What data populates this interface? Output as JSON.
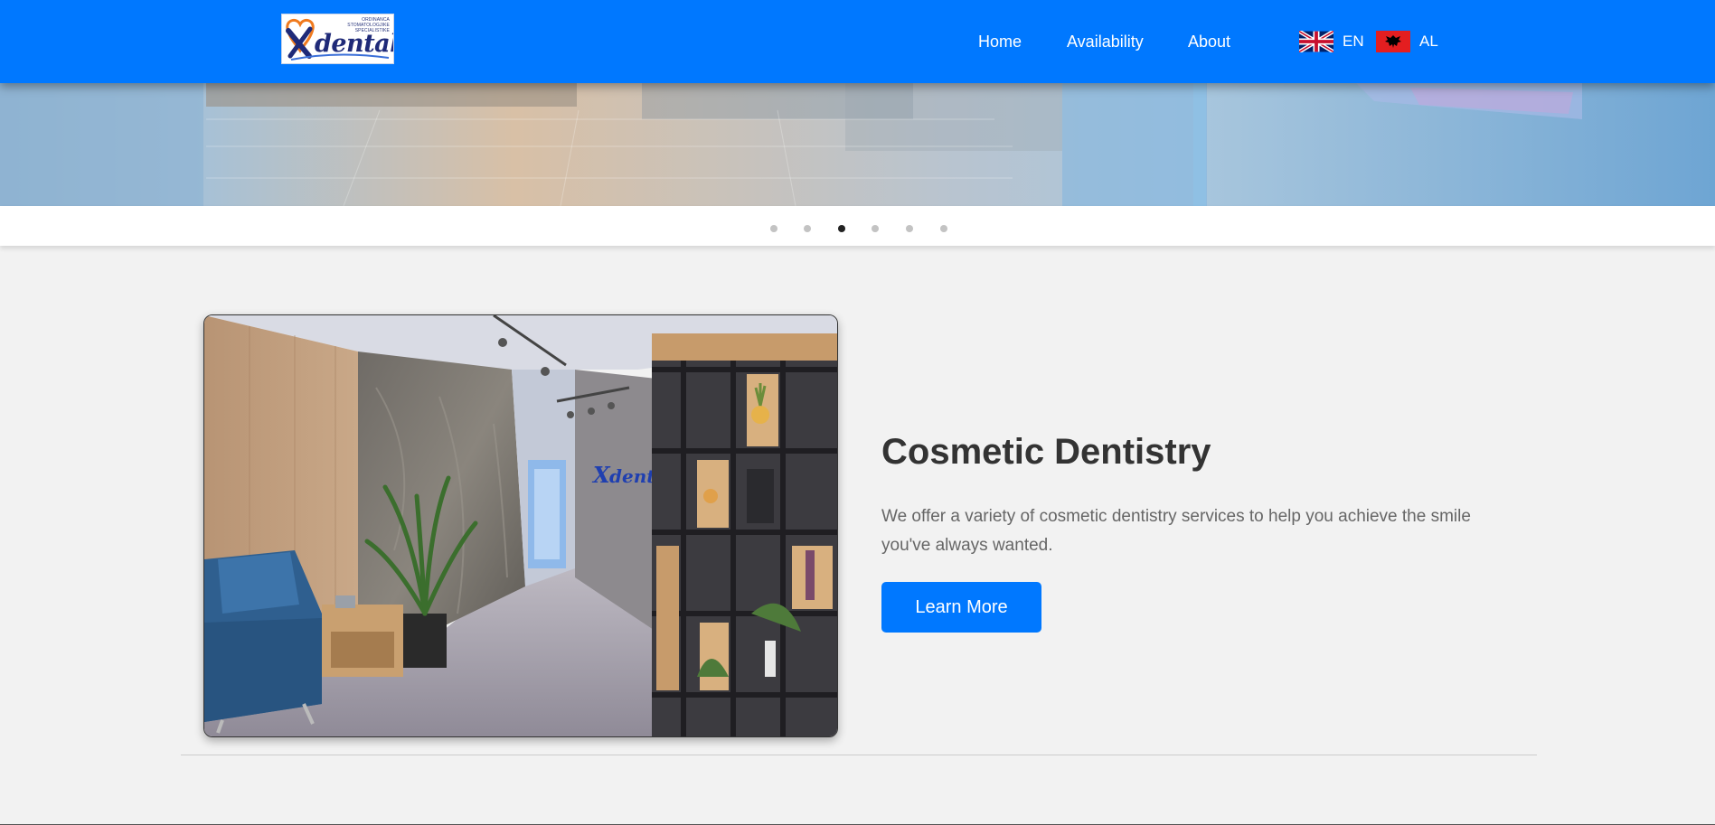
{
  "header": {
    "logo": {
      "tagline": "ORDINANCA STOMATOLOGJIKE SPECIALISTIKE",
      "wordmark": "dental"
    },
    "nav": [
      {
        "label": "Home"
      },
      {
        "label": "Availability"
      },
      {
        "label": "About"
      }
    ],
    "languages": [
      {
        "code": "EN",
        "flag": "uk-flag-icon"
      },
      {
        "code": "AL",
        "flag": "albania-flag-icon"
      }
    ]
  },
  "carousel": {
    "slide_count": 6,
    "active_index": 3
  },
  "feature": {
    "title": "Cosmetic Dentistry",
    "description": "We offer a variety of cosmetic dentistry services to help you achieve the smile you've always wanted.",
    "button_label": "Learn More"
  },
  "colors": {
    "brand_blue": "#0078ff",
    "page_background": "#f2f2f2",
    "title_text": "#333333",
    "body_text": "#666666"
  }
}
